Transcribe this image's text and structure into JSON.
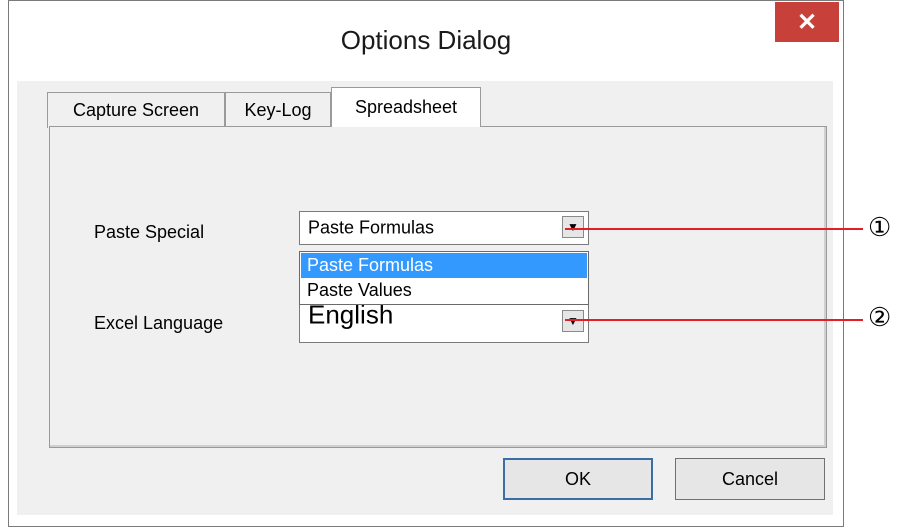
{
  "dialog": {
    "title": "Options Dialog",
    "close_label": "✕"
  },
  "tabs": [
    {
      "label": "Capture Screen",
      "active": false
    },
    {
      "label": "Key-Log",
      "active": false
    },
    {
      "label": "Spreadsheet",
      "active": true
    }
  ],
  "spreadsheet": {
    "paste_special_label": "Paste Special",
    "paste_special_value": "Paste Formulas",
    "paste_special_options": [
      "Paste Formulas",
      "Paste Values"
    ],
    "excel_language_label": "Excel Language",
    "excel_language_value": "English"
  },
  "buttons": {
    "ok": "OK",
    "cancel": "Cancel"
  },
  "callouts": [
    "①",
    "②"
  ],
  "colors": {
    "close_button": "#c7403a",
    "selection": "#3399ff",
    "callout_line": "#e31e24"
  }
}
